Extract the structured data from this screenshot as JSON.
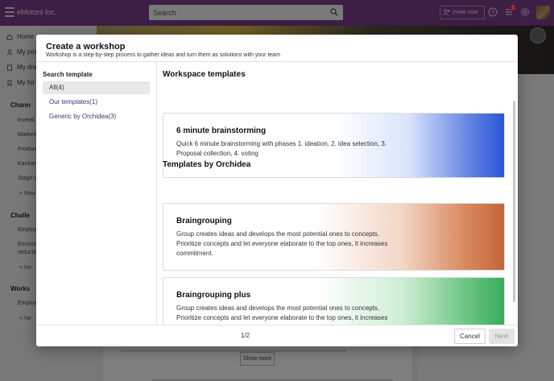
{
  "app": {
    "brand": "eMotors Inc.",
    "search_placeholder": "Search",
    "invite_label": "Invite user",
    "notification_count": "3"
  },
  "sidebar": {
    "items": [
      {
        "label": "Home",
        "icon": "home-icon"
      },
      {
        "label": "My pro",
        "icon": "user-icon"
      },
      {
        "label": "My dra",
        "icon": "draft-icon"
      },
      {
        "label": "My fol",
        "icon": "bookmark-icon"
      }
    ],
    "sections": [
      {
        "title": "Chann",
        "icon": "megaphone-icon",
        "subs": [
          "Inventi",
          "Marketi",
          "Product",
          "Kanban",
          "Stage-g"
        ],
        "new": "+ New"
      },
      {
        "title": "Challe",
        "icon": "bulb-icon",
        "subs": [
          "Employ",
          "Environ",
          "reductio"
        ],
        "new": "+ Ne"
      },
      {
        "title": "Works",
        "icon": "gear-icon",
        "subs": [
          "Employ"
        ],
        "new": "+ Ne"
      }
    ]
  },
  "background": {
    "show_more": "Show more"
  },
  "modal": {
    "title": "Create a workshop",
    "subtitle": "Workshop is a step-by-step process to gather ideas and turn them as solutions with your team",
    "search_label": "Search template",
    "filters": [
      {
        "label": "All(4)",
        "active": true
      },
      {
        "label": "Our templates(1)",
        "active": false
      },
      {
        "label": "Generic by Orchidea(3)",
        "active": false
      }
    ],
    "section_workspace": "Workspace templates",
    "section_orchidea": "Templates by Orchidea",
    "templates": [
      {
        "name": "6 minute brainstorming",
        "description": "Quick 6 minute brainstorming with phases 1. ideation, 2. idea selection, 3. Proposal collection, 4. voting",
        "accent": "#2a55d6"
      },
      {
        "name": "Braingrouping",
        "description": "Group creates ideas and develops the most potential ones to concepts. Prioritize concepts and let everyone elaborate to the top ones, it increases commitment.",
        "accent": "#c4653a"
      },
      {
        "name": "Braingrouping plus",
        "description": "Group creates ideas and develops the most potential ones to concepts. Prioritize concepts and let everyone elaborate to the top ones, it increases commitment.",
        "accent": "#39ab5c"
      }
    ],
    "pager": "1/2",
    "cancel_label": "Cancel",
    "next_label": "Next"
  },
  "colors": {
    "topbar": "#7b3c89",
    "link": "#4a2f78"
  }
}
